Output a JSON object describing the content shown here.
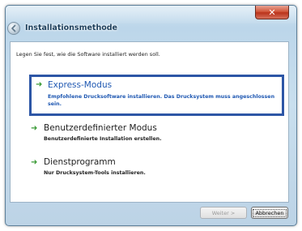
{
  "window": {
    "close_glyph": "✕",
    "title": "Installationsmethode"
  },
  "content": {
    "prompt": "Legen Sie fest, wie die Software installiert werden soll.",
    "options": [
      {
        "title": "Express-Modus",
        "description": "Empfohlene Drucksoftware installieren. Das Drucksystem muss angeschlossen sein.",
        "selected": true
      },
      {
        "title": "Benutzerdefinierter Modus",
        "description": "Benutzerdefinierte Installation erstellen.",
        "selected": false
      },
      {
        "title": "Dienstprogramm",
        "description": "Nur Drucksystem-Tools installieren.",
        "selected": false
      }
    ],
    "arrow_glyph": "➜"
  },
  "footer": {
    "next_label": "Weiter >",
    "cancel_label": "Abbrechen"
  },
  "colors": {
    "selection_border": "#2d56a6",
    "selected_text": "#1f58b2",
    "arrow": "#3a9a36"
  }
}
